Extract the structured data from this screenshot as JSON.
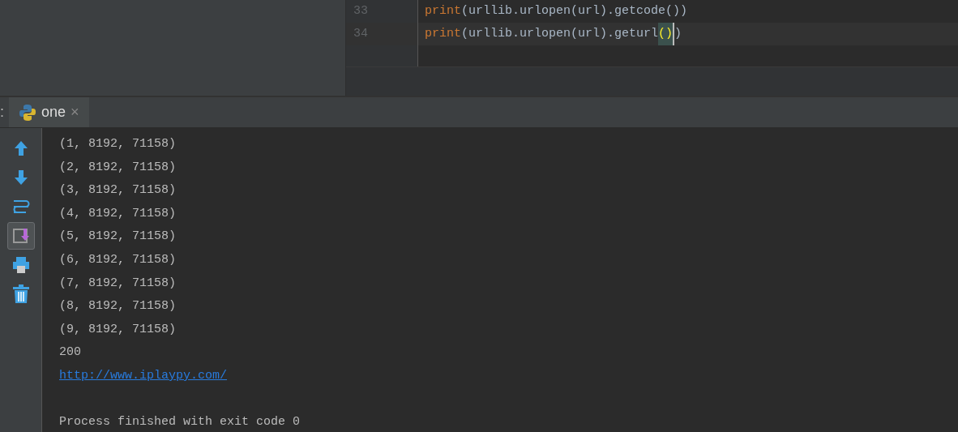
{
  "editor": {
    "lines": [
      {
        "number": "33",
        "current": false,
        "tokens": [
          {
            "text": "print",
            "kind": "keyword"
          },
          {
            "text": "(urllib.urlopen(url).getcode())",
            "kind": "plain"
          }
        ]
      },
      {
        "number": "34",
        "current": true,
        "tokens": [
          {
            "text": "print",
            "kind": "keyword"
          },
          {
            "text": "(urllib.urlopen(url).geturl",
            "kind": "plain"
          },
          {
            "text": "()",
            "kind": "brace-match"
          },
          {
            "text": ")",
            "kind": "plain"
          }
        ]
      }
    ]
  },
  "run_panel": {
    "label": ":",
    "tabs": [
      {
        "label": "one",
        "close": "×",
        "selected": true
      }
    ]
  },
  "toolbar": [
    {
      "kind": "up",
      "on": false
    },
    {
      "kind": "down",
      "on": false
    },
    {
      "kind": "wrap",
      "on": false
    },
    {
      "kind": "scroll-end",
      "on": true
    },
    {
      "kind": "print",
      "on": false
    },
    {
      "kind": "trash",
      "on": false
    }
  ],
  "console": [
    {
      "kind": "text",
      "text": "(1, 8192, 71158)"
    },
    {
      "kind": "text",
      "text": "(2, 8192, 71158)"
    },
    {
      "kind": "text",
      "text": "(3, 8192, 71158)"
    },
    {
      "kind": "text",
      "text": "(4, 8192, 71158)"
    },
    {
      "kind": "text",
      "text": "(5, 8192, 71158)"
    },
    {
      "kind": "text",
      "text": "(6, 8192, 71158)"
    },
    {
      "kind": "text",
      "text": "(7, 8192, 71158)"
    },
    {
      "kind": "text",
      "text": "(8, 8192, 71158)"
    },
    {
      "kind": "text",
      "text": "(9, 8192, 71158)"
    },
    {
      "kind": "text",
      "text": "200"
    },
    {
      "kind": "link",
      "text": "http://www.iplaypy.com/"
    },
    {
      "kind": "status",
      "text": "Process finished with exit code 0"
    }
  ]
}
